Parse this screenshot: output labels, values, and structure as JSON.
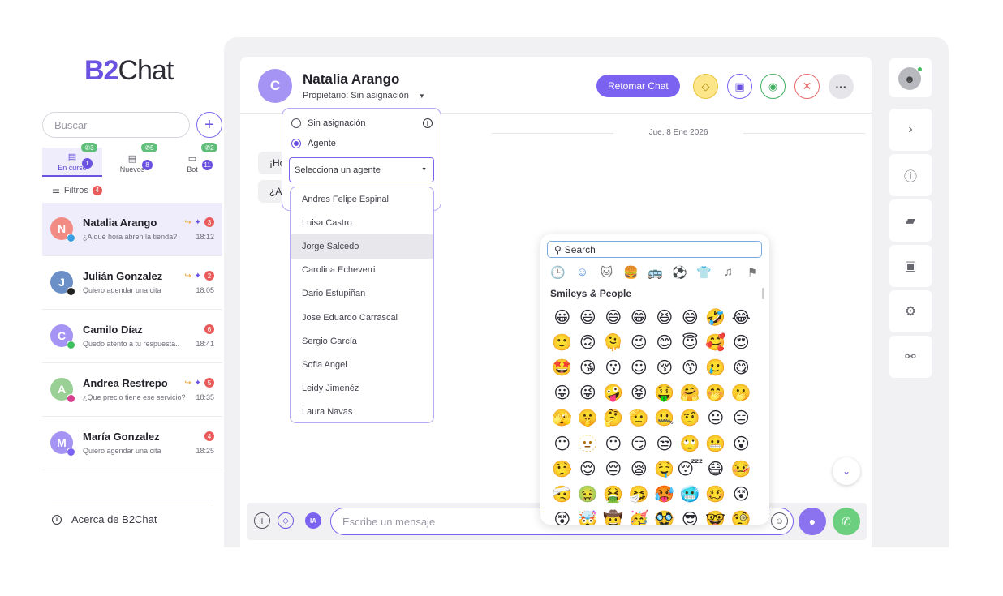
{
  "brand": {
    "logo_b2": "B2",
    "logo_chat": "Chat"
  },
  "sidebar": {
    "search_placeholder": "Buscar",
    "tabs": [
      {
        "label": "En curso",
        "count": "1",
        "whatsapp_count": "3",
        "active": true
      },
      {
        "label": "Nuevos",
        "count": "8",
        "whatsapp_count": "5",
        "active": false
      },
      {
        "label": "Bot",
        "count": "11",
        "whatsapp_count": "2",
        "active": false
      }
    ],
    "filters": {
      "label": "Filtros",
      "count": "4"
    },
    "conversations": [
      {
        "initial": "N",
        "name": "Natalia Arango",
        "message": "¿A qué hora abren la tienda?",
        "time": "18:12",
        "unread": "3",
        "avatar_color": "#f18b84",
        "channel": "telegram",
        "forwarded": true,
        "pinned": true
      },
      {
        "initial": "J",
        "name": "Julián Gonzalez",
        "message": "Quiero agendar una cita",
        "time": "18:05",
        "unread": "2",
        "avatar_color": "#6b8fc7",
        "channel": "messenger-dark",
        "forwarded": true,
        "pinned": true
      },
      {
        "initial": "C",
        "name": "Camilo Díaz",
        "message": "Quedo atento a tu respuesta..",
        "time": "18:41",
        "unread": "6",
        "avatar_color": "#a594f4",
        "channel": "whatsapp",
        "forwarded": false,
        "pinned": false
      },
      {
        "initial": "A",
        "name": "Andrea Restrepo",
        "message": "¿Que precio tiene ese servicio?",
        "time": "18:35",
        "unread": "5",
        "avatar_color": "#9ad095",
        "channel": "instagram",
        "forwarded": true,
        "pinned": true
      },
      {
        "initial": "M",
        "name": "María Gonzalez",
        "message": "Quiero agendar una cita",
        "time": "18:25",
        "unread": "4",
        "avatar_color": "#a594f4",
        "channel": "messenger",
        "forwarded": false,
        "pinned": false
      }
    ],
    "about_label": "Acerca de B2Chat"
  },
  "chat": {
    "contact_initial": "C",
    "contact_name": "Natalia Arango",
    "owner_label": "Propietario: Sin asignación",
    "retomar_label": "Retomar Chat",
    "date_separator": "Jue, 8 Ene 2026",
    "bubbles": [
      "¡Ho",
      "¿A"
    ],
    "composer_placeholder": "Escribe un mensaje",
    "ia_label": "IA"
  },
  "assign_popover": {
    "option_unassigned": "Sin asignación",
    "option_agent": "Agente",
    "selected_option": "Agente",
    "select_placeholder": "Selecciona un agente",
    "agents": [
      "Andres Felipe Espinal",
      "Luisa Castro",
      "Jorge Salcedo",
      "Carolina Echeverri",
      "Dario Estupiñan",
      "Jose Eduardo Carrascal",
      "Sergio García",
      "Sofia Angel",
      "Leidy Jimenéz",
      "Laura Navas"
    ],
    "hovered_agent": "Jorge Salcedo"
  },
  "emoji_picker": {
    "search_value": "Search",
    "section_title": "Smileys & People",
    "categories": [
      "🕒",
      "☺",
      "🐱",
      "🍔",
      "🚌",
      "⚽",
      "👕",
      "♫",
      "⚑"
    ],
    "emojis": [
      "😀",
      "😃",
      "😄",
      "😁",
      "😆",
      "😅",
      "🤣",
      "😂",
      "🙂",
      "🙃",
      "🫠",
      "😉",
      "😊",
      "😇",
      "🥰",
      "😍",
      "🤩",
      "😘",
      "😗",
      "☺",
      "😚",
      "😙",
      "🥲",
      "😋",
      "😛",
      "😜",
      "🤪",
      "😝",
      "🤑",
      "🤗",
      "🤭",
      "🫢",
      "🫣",
      "🤫",
      "🤔",
      "🫡",
      "🤐",
      "🤨",
      "😐",
      "😑",
      "😶",
      "🫥",
      "😶",
      "😏",
      "😒",
      "🙄",
      "😬",
      "😮",
      "🤥",
      "😌",
      "😔",
      "😪",
      "🤤",
      "😴",
      "😷",
      "🤒",
      "🤕",
      "🤢",
      "🤮",
      "🤧",
      "🥵",
      "🥶",
      "🥴",
      "😵",
      "😵",
      "🤯",
      "🤠",
      "🥳",
      "🥸",
      "😎",
      "🤓",
      "🧐"
    ]
  },
  "colors": {
    "accent": "#7b62f0",
    "danger": "#e95b5b",
    "success": "#3fae5f"
  }
}
